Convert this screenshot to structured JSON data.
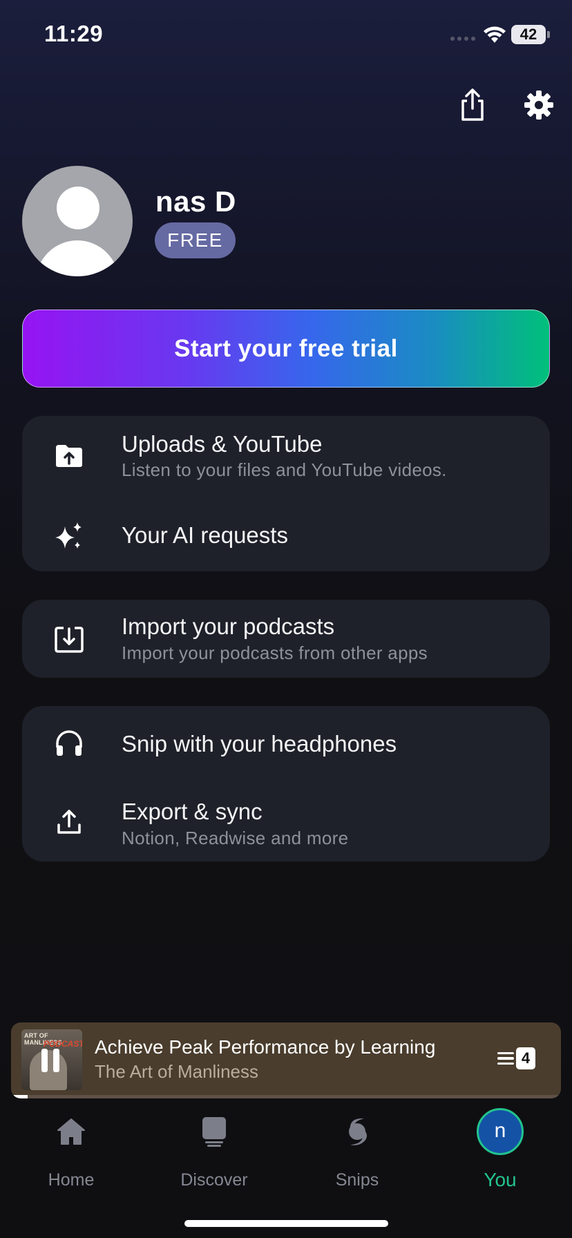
{
  "status_bar": {
    "time": "11:29",
    "battery": "42"
  },
  "profile": {
    "name": "nas D",
    "plan": "FREE"
  },
  "trial_button": {
    "label": "Start your free trial"
  },
  "cards": [
    {
      "rows": [
        {
          "icon": "folder-upload-icon",
          "title": "Uploads & YouTube",
          "subtitle": "Listen to your files and YouTube videos."
        },
        {
          "icon": "sparkles-icon",
          "title": "Your AI requests"
        }
      ]
    },
    {
      "rows": [
        {
          "icon": "import-icon",
          "title": "Import your podcasts",
          "subtitle": "Import your podcasts from other apps"
        }
      ]
    },
    {
      "rows": [
        {
          "icon": "headphones-icon",
          "title": "Snip with your headphones"
        },
        {
          "icon": "export-icon",
          "title": "Export & sync",
          "subtitle": "Notion, Readwise and more"
        }
      ]
    }
  ],
  "mini_player": {
    "title": "Achieve Peak Performance by Learning",
    "show": "The Art of Manliness",
    "cover_title": "ART OF MANLINESS",
    "cover_subtitle": "PODCAST",
    "queue_count": "4",
    "progress": 0.03
  },
  "tabs": [
    {
      "label": "Home",
      "icon": "home-icon"
    },
    {
      "label": "Discover",
      "icon": "discover-icon"
    },
    {
      "label": "Snips",
      "icon": "snips-icon"
    },
    {
      "label": "You",
      "icon": "avatar",
      "avatar_letter": "n",
      "active": true
    }
  ],
  "colors": {
    "accent": "#22c48d",
    "card": "#1e2129",
    "badge": "#666aa3"
  }
}
